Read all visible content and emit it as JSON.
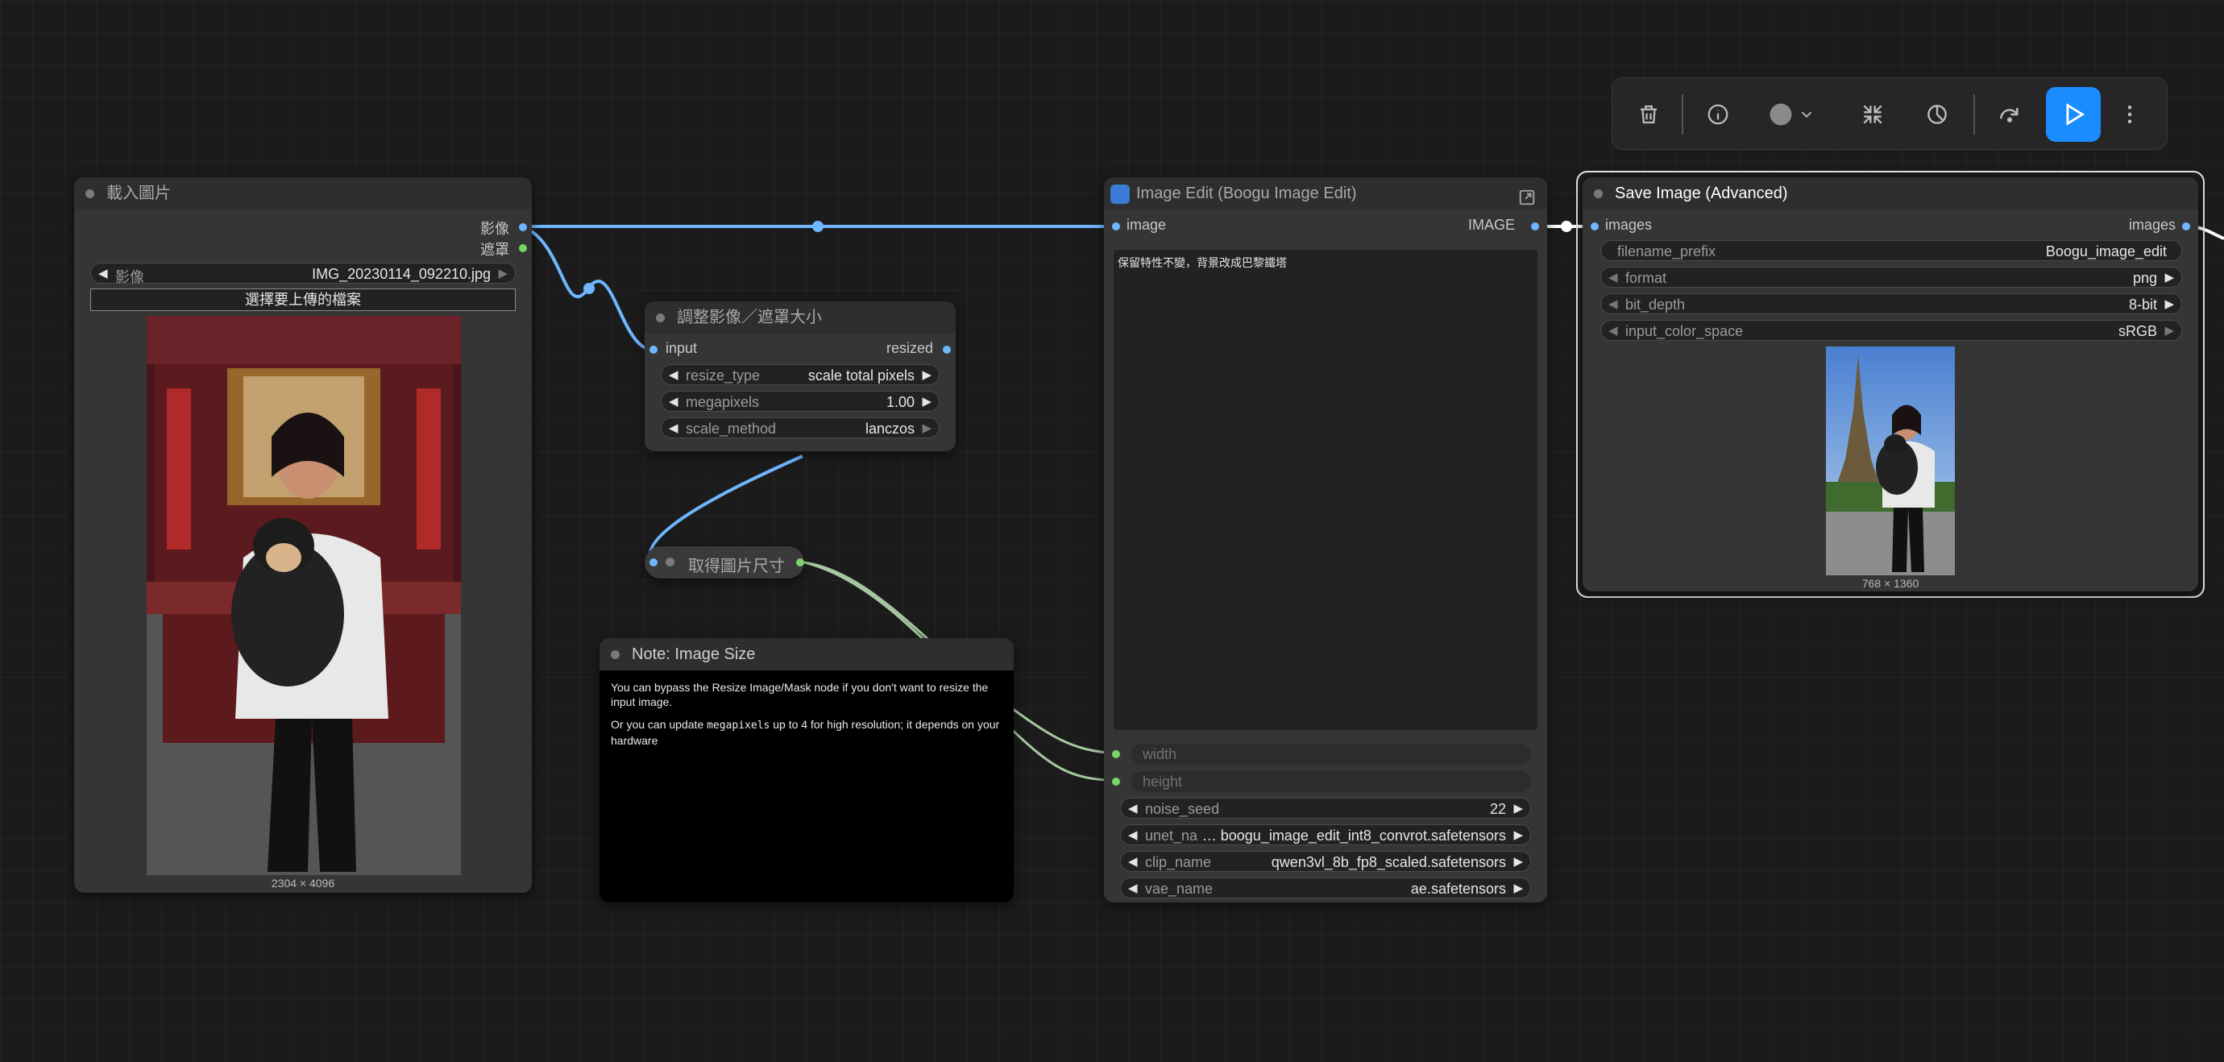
{
  "toolbar": {
    "delete_icon": "trash-icon",
    "info_icon": "info-icon",
    "color_icon": "color-circle-icon",
    "dropdown_icon": "chevron-down-icon",
    "collapse_icon": "collapse-arrows-icon",
    "bypass_icon": "bypass-icon",
    "redo_icon": "redo-icon",
    "run_icon": "play-icon",
    "more_icon": "more-vertical-icon",
    "accent_color": "#1a8cff"
  },
  "load_image": {
    "title": "載入圖片",
    "output_image": "影像",
    "output_mask": "遮罩",
    "widget_label": "影像",
    "filename": "IMG_20230114_092210.jpg",
    "upload_button": "選擇要上傳的檔案",
    "dimensions": "2304 × 4096"
  },
  "resize_node": {
    "title": "調整影像／遮罩大小",
    "input_label": "input",
    "output_label": "resized",
    "widgets": [
      {
        "label": "resize_type",
        "value": "scale total pixels"
      },
      {
        "label": "megapixels",
        "value": "1.00"
      },
      {
        "label": "scale_method",
        "value": "lanczos"
      }
    ]
  },
  "get_size_node": {
    "title": "取得圖片尺寸"
  },
  "note_node": {
    "title": "Note: Image Size",
    "para1": "You can bypass the Resize Image/Mask node if you don't want to resize the input image.",
    "para2_prefix": "Or you can update",
    "para2_code": "megapixels",
    "para2_suffix": "up to 4 for high resolution; it depends on your hardware"
  },
  "edit_node": {
    "title": "Image Edit (Boogu Image Edit)",
    "input_label": "image",
    "output_label": "IMAGE",
    "prompt": "保留特性不變，背景改成巴黎鐵塔",
    "width_label": "width",
    "height_label": "height",
    "widgets": [
      {
        "label": "noise_seed",
        "value": "22"
      },
      {
        "label": "unet_na",
        "value": "…  boogu_image_edit_int8_convrot.safetensors"
      },
      {
        "label": "clip_name",
        "value": "qwen3vl_8b_fp8_scaled.safetensors"
      },
      {
        "label": "vae_name",
        "value": "ae.safetensors"
      }
    ]
  },
  "save_node": {
    "title": "Save Image (Advanced)",
    "input_label": "images",
    "output_label": "images",
    "widgets": [
      {
        "label": "filename_prefix",
        "value": "Boogu_image_edit"
      },
      {
        "label": "format",
        "value": "png"
      },
      {
        "label": "bit_depth",
        "value": "8-bit"
      },
      {
        "label": "input_color_space",
        "value": "sRGB"
      }
    ],
    "dimensions": "768 × 1360"
  },
  "colors": {
    "image_link": "#6fb6ff",
    "int_link": "#a6c8a0",
    "int_slot": "#7bd36b"
  }
}
